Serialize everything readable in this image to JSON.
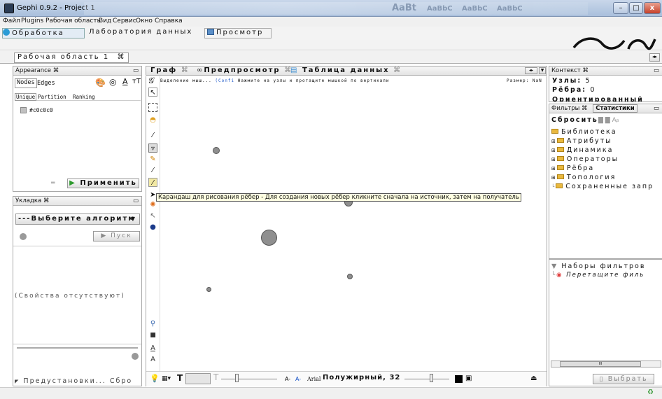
{
  "window": {
    "title": "Gephi 0.9.2 - Project 1",
    "ribbon_texts": [
      "AaBt",
      "AaBbC",
      "AaBbC",
      "AaBbC"
    ],
    "minimize": "–",
    "maximize": "□",
    "close": "x"
  },
  "menu": [
    "Файл",
    "Plugins",
    "Рабочая область",
    "Вид",
    "Сервис",
    "Окно",
    "Справка"
  ],
  "modes": {
    "overview": "Обработка",
    "data_lab": "Лаборатория данных",
    "preview": "Просмотр"
  },
  "workspace_tab": "Рабочая область 1",
  "workspace_tab_close": "⌘",
  "appearance": {
    "title": "Appearance ⌘",
    "tabs": [
      "Nodes",
      "Edges"
    ],
    "subtabs": [
      "Unique",
      "Partition",
      "Ranking"
    ],
    "color_value": "#c0c0c0",
    "apply_label": "Применить"
  },
  "layout": {
    "title": "Укладка ⌘",
    "select_label": "---Выберите алгоритм",
    "run_label": "Пуск",
    "no_properties": "(Свойства отсутствуют)",
    "presets_label": "Предустановки...",
    "reset_label": "Сбро"
  },
  "graph_tabs": {
    "graph": "Граф",
    "preview": "Предпросмотр",
    "table": "Таблица данных",
    "close": "⌘"
  },
  "graph_toolbar": {
    "hint_prefix": "Выделение мыш...",
    "hint_link": "(Confi",
    "hint": "Нажмите на узлы и протащите мышкой по вертикали",
    "size": "Размер: NaN"
  },
  "tooltip": "Карандаш для рисования рёбер - Для создания новых рёбер кликните сначала на источник, затем на получатель",
  "bottom_toolbar": {
    "font_a1": "A",
    "font_a2": "A",
    "font_name": "Arial",
    "font_style": "Полужирный, 32"
  },
  "context": {
    "title": "Контекст ⌘",
    "nodes_label": "Узлы:",
    "nodes_value": "5",
    "edges_label": "Рёбра:",
    "edges_value": "0",
    "directed": "Ориентированный"
  },
  "filters": {
    "tab_filters": "Фильтры ⌘",
    "tab_stats": "Статистики",
    "reset": "Сбросить",
    "library": "Библиотека",
    "items": [
      "Атрибуты",
      "Динамика",
      "Операторы",
      "Рёбра",
      "Топология",
      "Сохраненные запр"
    ],
    "queries": "Наборы фильтров",
    "drag_hint": "Перетащите филь",
    "select_button": "Выбрать",
    "scroll": "III"
  },
  "colors": {
    "accent": "#2a9bd6",
    "node_fill": "#8f8f8f",
    "tooltip_bg": "#ffffe1",
    "folder": "#e9b83e"
  }
}
